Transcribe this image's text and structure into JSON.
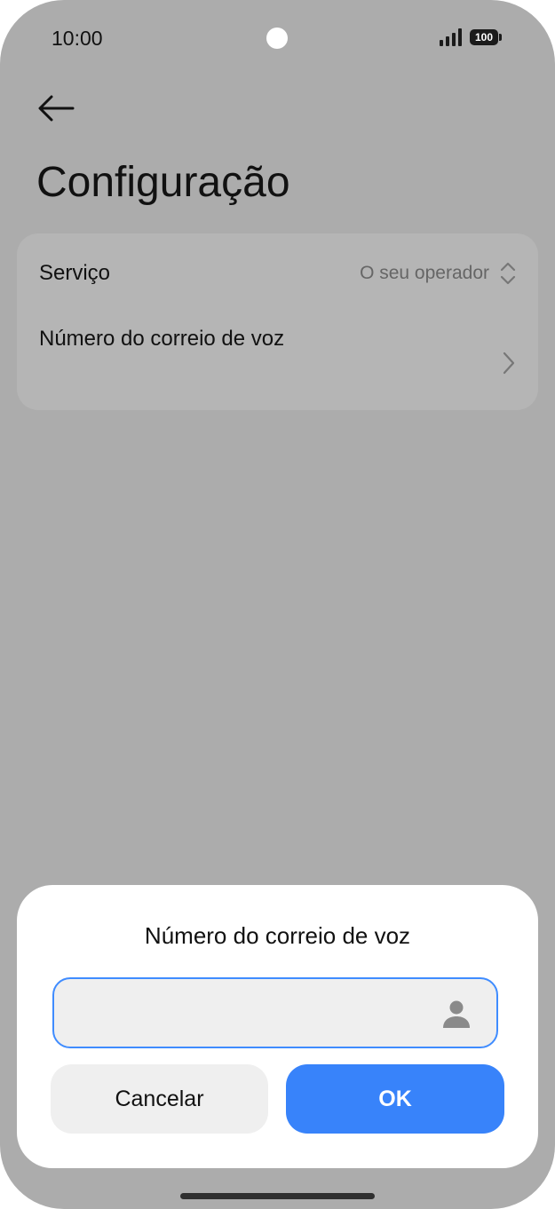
{
  "status_bar": {
    "time": "10:00",
    "battery": "100",
    "icons": [
      "signal-icon",
      "battery-icon"
    ]
  },
  "header": {
    "back_icon": "arrow-left-icon",
    "title": "Configuração"
  },
  "settings": {
    "service": {
      "label": "Serviço",
      "value": "O seu operador",
      "icon": "up-down-chevron-icon"
    },
    "voicemail": {
      "label": "Número do correio de voz",
      "icon": "chevron-right-icon"
    }
  },
  "dialog": {
    "title": "Número do correio de voz",
    "input": {
      "value": "",
      "placeholder": ""
    },
    "contact_icon": "contact-person-icon",
    "cancel_label": "Cancelar",
    "ok_label": "OK"
  },
  "colors": {
    "dim_background": "#acacac",
    "card_background": "#b5b5b5",
    "accent": "#3883fa",
    "input_border": "#3f8cff"
  }
}
